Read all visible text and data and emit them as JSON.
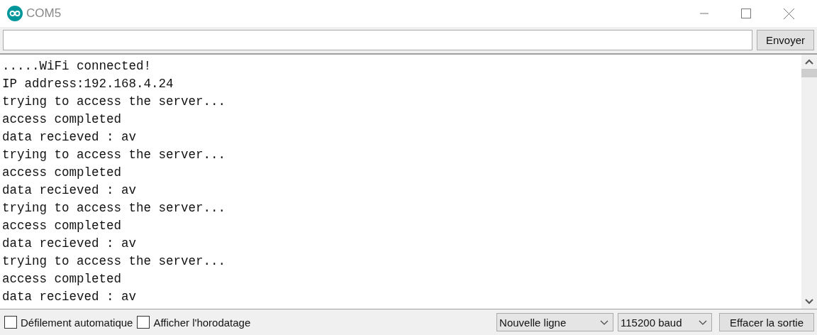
{
  "window": {
    "title": "COM5"
  },
  "send": {
    "button": "Envoyer"
  },
  "output": {
    "lines": [
      ".....WiFi connected!",
      "IP address:192.168.4.24",
      "trying to access the server...",
      "access completed",
      "data recieved : av",
      "trying to access the server...",
      "access completed",
      "data recieved : av",
      "trying to access the server...",
      "access completed",
      "data recieved : av",
      "trying to access the server...",
      "access completed",
      "data recieved : av"
    ]
  },
  "footer": {
    "checkboxes": [
      {
        "label": "Défilement automatique",
        "checked": false
      },
      {
        "label": "Afficher l'horodatage",
        "checked": false
      }
    ],
    "selects": [
      "Nouvelle ligne",
      "115200 baud"
    ],
    "clear_button": "Effacer la sortie"
  }
}
